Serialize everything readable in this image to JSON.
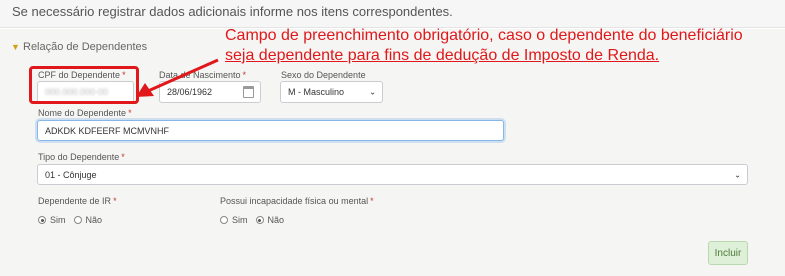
{
  "header": {
    "text": "Se necessário registrar dados adicionais informe nos itens correspondentes."
  },
  "section": {
    "title": "Relação de Dependentes"
  },
  "fields": {
    "cpf": {
      "label": "CPF do Dependente",
      "required": "*",
      "value": "000.000.000-00"
    },
    "nascimento": {
      "label": "Data de Nascimento",
      "required": "*",
      "value": "28/06/1962"
    },
    "sexo": {
      "label": "Sexo do Dependente",
      "value": "M - Masculino"
    },
    "nome": {
      "label": "Nome do Dependente",
      "required": "*",
      "value": "ADKDK KDFEERF MCMVNHF"
    },
    "tipo": {
      "label": "Tipo do Dependente",
      "required": "*",
      "value": "01 - Cônjuge"
    },
    "ir": {
      "label": "Dependente de IR",
      "required": "*",
      "options": [
        "Sim",
        "Não"
      ],
      "selected": "Sim"
    },
    "incapacidade": {
      "label": "Possui incapacidade física ou mental",
      "required": "*",
      "options": [
        "Sim",
        "Não"
      ],
      "selected": "Não"
    }
  },
  "actions": {
    "incluir": "Incluir"
  },
  "annotation": {
    "line1": "Campo de preenchimento obrigatório, caso o dependente do beneficiário",
    "line2": "seja dependente para fins de dedução de Imposto de Renda."
  },
  "colors": {
    "annotation": "#e0181b",
    "required": "#c0392b",
    "button_bg": "#dff0d8"
  },
  "icons": {
    "section_caret": "caret-down-icon",
    "calendar": "calendar-icon",
    "select": "chevron-down-icon"
  }
}
